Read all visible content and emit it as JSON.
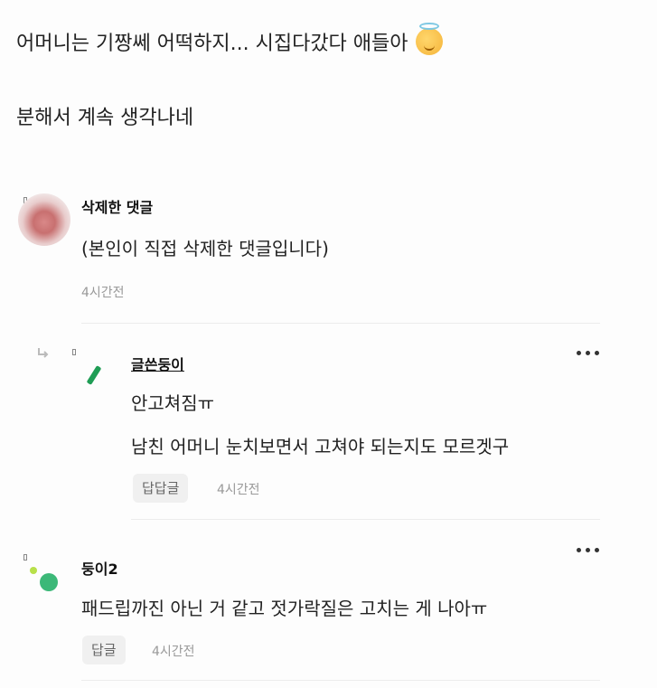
{
  "post": {
    "line1": "어머니는 기짱쎄 어떡하지... 시집다갔다 애들아",
    "line2": "분해서 계속 생각나네"
  },
  "comments": [
    {
      "author": "삭제한 댓글",
      "text": "(본인이 직접 삭제한 댓글입니다)",
      "time": "4시간전"
    },
    {
      "author": "글쓴둥이",
      "lines": [
        "안고쳐짐ㅠ",
        "남친 어머니 눈치보면서 고쳐야 되는지도 모르겟구"
      ],
      "reply_label": "답답글",
      "time": "4시간전"
    },
    {
      "author": "둥이2",
      "text": "패드립까진 아닌 거 같고 젓가락질은 고치는 게 나아ㅠ",
      "reply_label": "답글",
      "time": "4시간전"
    }
  ],
  "colors": {
    "accent_green": "#1f9d55",
    "text": "#222222",
    "muted": "#999999"
  },
  "icons": [
    "angel-emoji-icon",
    "reply-arrow-icon",
    "more-options-icon"
  ]
}
